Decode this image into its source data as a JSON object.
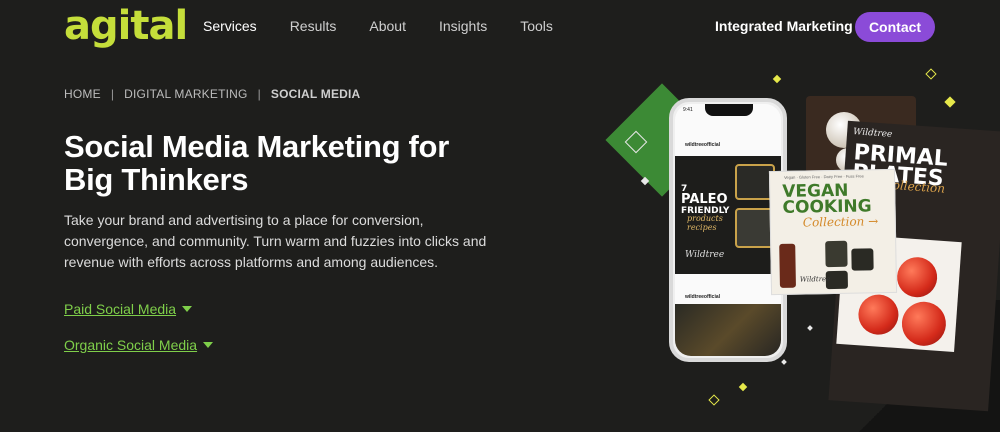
{
  "brand": {
    "logo_text": "agital",
    "logo_color": "#c5de3a"
  },
  "nav": {
    "items": [
      {
        "label": "Services"
      },
      {
        "label": "Results"
      },
      {
        "label": "About"
      },
      {
        "label": "Insights"
      },
      {
        "label": "Tools"
      }
    ],
    "integrated_label": "Integrated Marketing",
    "contact_label": "Contact",
    "contact_color": "#8b4bd8"
  },
  "breadcrumb": {
    "items": [
      "HOME",
      "DIGITAL MARKETING",
      "SOCIAL MEDIA"
    ],
    "separator": "|"
  },
  "main": {
    "title": "Social Media Marketing for Big Thinkers",
    "description": "Take your brand and advertising to a place for conversion, convergence, and community. Turn warm and fuzzies into clicks and revenue with efforts across platforms and among audiences.",
    "links": [
      {
        "label": "Paid Social Media",
        "icon": "caret-down-icon"
      },
      {
        "label": "Organic Social Media",
        "icon": "caret-down-icon"
      }
    ],
    "link_color": "#7fcf4a"
  },
  "hero": {
    "phone": {
      "time": "9:41",
      "handle_1": "wildtreeofficial",
      "handle_2": "wildtreeofficial",
      "post_number": "7",
      "post_title_1": "PALEO",
      "post_title_2": "FRIENDLY",
      "post_sub_1": "products",
      "post_sub_2": "recipes",
      "post_brand": "Wildtree"
    },
    "vegan_card": {
      "top_text": "Vegan · Gluten Free · Dairy Free · Fuss Free",
      "title_1": "VEGAN",
      "title_2": "COOKING",
      "subtitle": "Collection →",
      "brand": "Wildtree"
    },
    "primal_card": {
      "brand": "Wildtree",
      "title_1": "PRIMAL",
      "title_2": "PLATES",
      "subtitle": "Collection"
    },
    "accent_green": "#3c8a35",
    "accent_yellow": "#e6e84a"
  }
}
